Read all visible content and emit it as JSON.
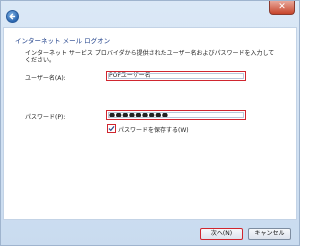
{
  "window": {
    "close_glyph": "✕"
  },
  "page": {
    "title": "インターネット メール ログオン",
    "description": "インターネット サービス プロバイダから提供されたユーザー名およびパスワードを入力してください。"
  },
  "form": {
    "username_label": "ユーザー名(A):",
    "username_value": "POFユーザー名",
    "password_label": "パスワード(P):",
    "password_value": "●●●●●●●●●",
    "remember_label": "パスワードを保存する(W)",
    "remember_checked": true
  },
  "footer": {
    "next_label": "次へ(N)",
    "cancel_label": "キャンセル"
  },
  "colors": {
    "heading": "#1e3f8a",
    "highlight_border": "#d0262f",
    "window_frame": "#c9dbef"
  },
  "icons": {
    "back": "back-arrow-icon",
    "close": "close-icon",
    "check": "checkmark-icon"
  }
}
